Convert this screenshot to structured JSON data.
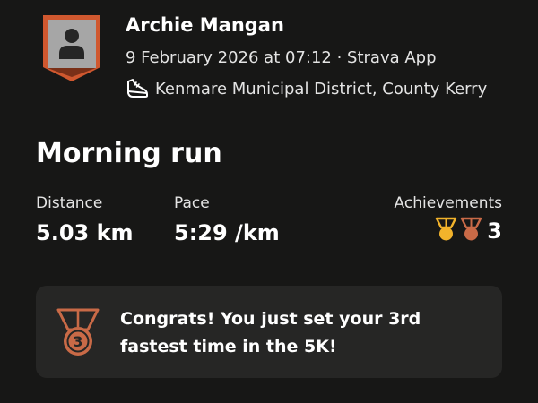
{
  "athlete": {
    "name": "Archie Mangan",
    "meta": "9 February 2026 at 07:12 · Strava App",
    "location": "Kenmare Municipal District, County Kerry",
    "avatar_icon": "default-user-avatar-icon",
    "avatar_frame_color": "#d0582f"
  },
  "activity": {
    "title": "Morning run",
    "type_icon": "running-shoe-icon"
  },
  "stats": {
    "distance": {
      "label": "Distance",
      "value": "5.03 km"
    },
    "pace": {
      "label": "Pace",
      "value": "5:29 /km"
    },
    "achievements": {
      "label": "Achievements",
      "count": "3",
      "icons": [
        "gold-medal-icon",
        "bronze-medal-icon"
      ],
      "colors": {
        "gold": "#f2b32b",
        "bronze": "#c96a47"
      }
    }
  },
  "congrats": {
    "text": "Congrats! You just set your 3rd fastest time in the 5K!",
    "medal_number": "3",
    "medal_color": "#c96a47"
  }
}
